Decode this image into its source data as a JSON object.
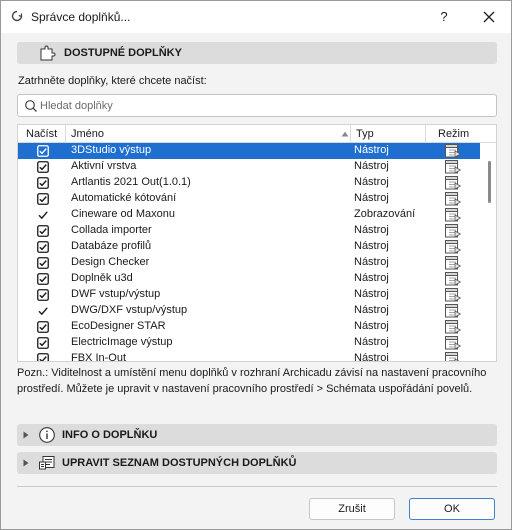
{
  "window": {
    "title": "Správce doplňků...",
    "help_label": "?"
  },
  "available_section": {
    "label": "DOSTUPNÉ DOPLŇKY",
    "icon": "puzzle-icon"
  },
  "instruction": "Zatrhněte doplňky, které chcete načíst:",
  "search": {
    "placeholder": "Hledat doplňky",
    "value": ""
  },
  "table": {
    "columns": {
      "load": "Načíst",
      "name": "Jméno",
      "type": "Typ",
      "mode": "Režim"
    },
    "sort_column": "name",
    "rows": [
      {
        "name": "3DStudio výstup",
        "type": "Nástroj",
        "check": "box",
        "selected": true
      },
      {
        "name": "Aktivní vrstva",
        "type": "Nástroj",
        "check": "box",
        "selected": false
      },
      {
        "name": "Artlantis 2021 Out(1.0.1)",
        "type": "Nástroj",
        "check": "box",
        "selected": false
      },
      {
        "name": "Automatické kótování",
        "type": "Nástroj",
        "check": "box",
        "selected": false
      },
      {
        "name": "Cineware od Maxonu",
        "type": "Zobrazování",
        "check": "tick",
        "selected": false
      },
      {
        "name": "Collada importer",
        "type": "Nástroj",
        "check": "box",
        "selected": false
      },
      {
        "name": "Databáze profilů",
        "type": "Nástroj",
        "check": "box",
        "selected": false
      },
      {
        "name": "Design Checker",
        "type": "Nástroj",
        "check": "box",
        "selected": false
      },
      {
        "name": "Doplněk u3d",
        "type": "Nástroj",
        "check": "box",
        "selected": false
      },
      {
        "name": "DWF vstup/výstup",
        "type": "Nástroj",
        "check": "box",
        "selected": false
      },
      {
        "name": "DWG/DXF vstup/výstup",
        "type": "Nástroj",
        "check": "tick",
        "selected": false
      },
      {
        "name": "EcoDesigner STAR",
        "type": "Nástroj",
        "check": "box",
        "selected": false
      },
      {
        "name": "ElectricImage výstup",
        "type": "Nástroj",
        "check": "box",
        "selected": false
      },
      {
        "name": "FBX In-Out",
        "type": "Nástroj",
        "check": "box",
        "selected": false
      }
    ]
  },
  "note": "Pozn.: Viditelnost a umístění menu doplňků v rozhraní Archicadu závisí na nastavení pracovního prostředí. Můžete je upravit v nastavení pracovního prostředí > Schémata uspořádání povelů.",
  "info_section": {
    "label": "INFO O DOPLŇKU",
    "icon": "info-icon"
  },
  "edit_section": {
    "label": "UPRAVIT SEZNAM DOSTUPNÝCH DOPLŇKŮ",
    "icon": "edit-list-icon"
  },
  "buttons": {
    "cancel": "Zrušit",
    "ok": "OK"
  },
  "colors": {
    "selection": "#1e6fcf",
    "header_bg": "#dcdcdc",
    "window_bg": "#f3f3f3"
  }
}
